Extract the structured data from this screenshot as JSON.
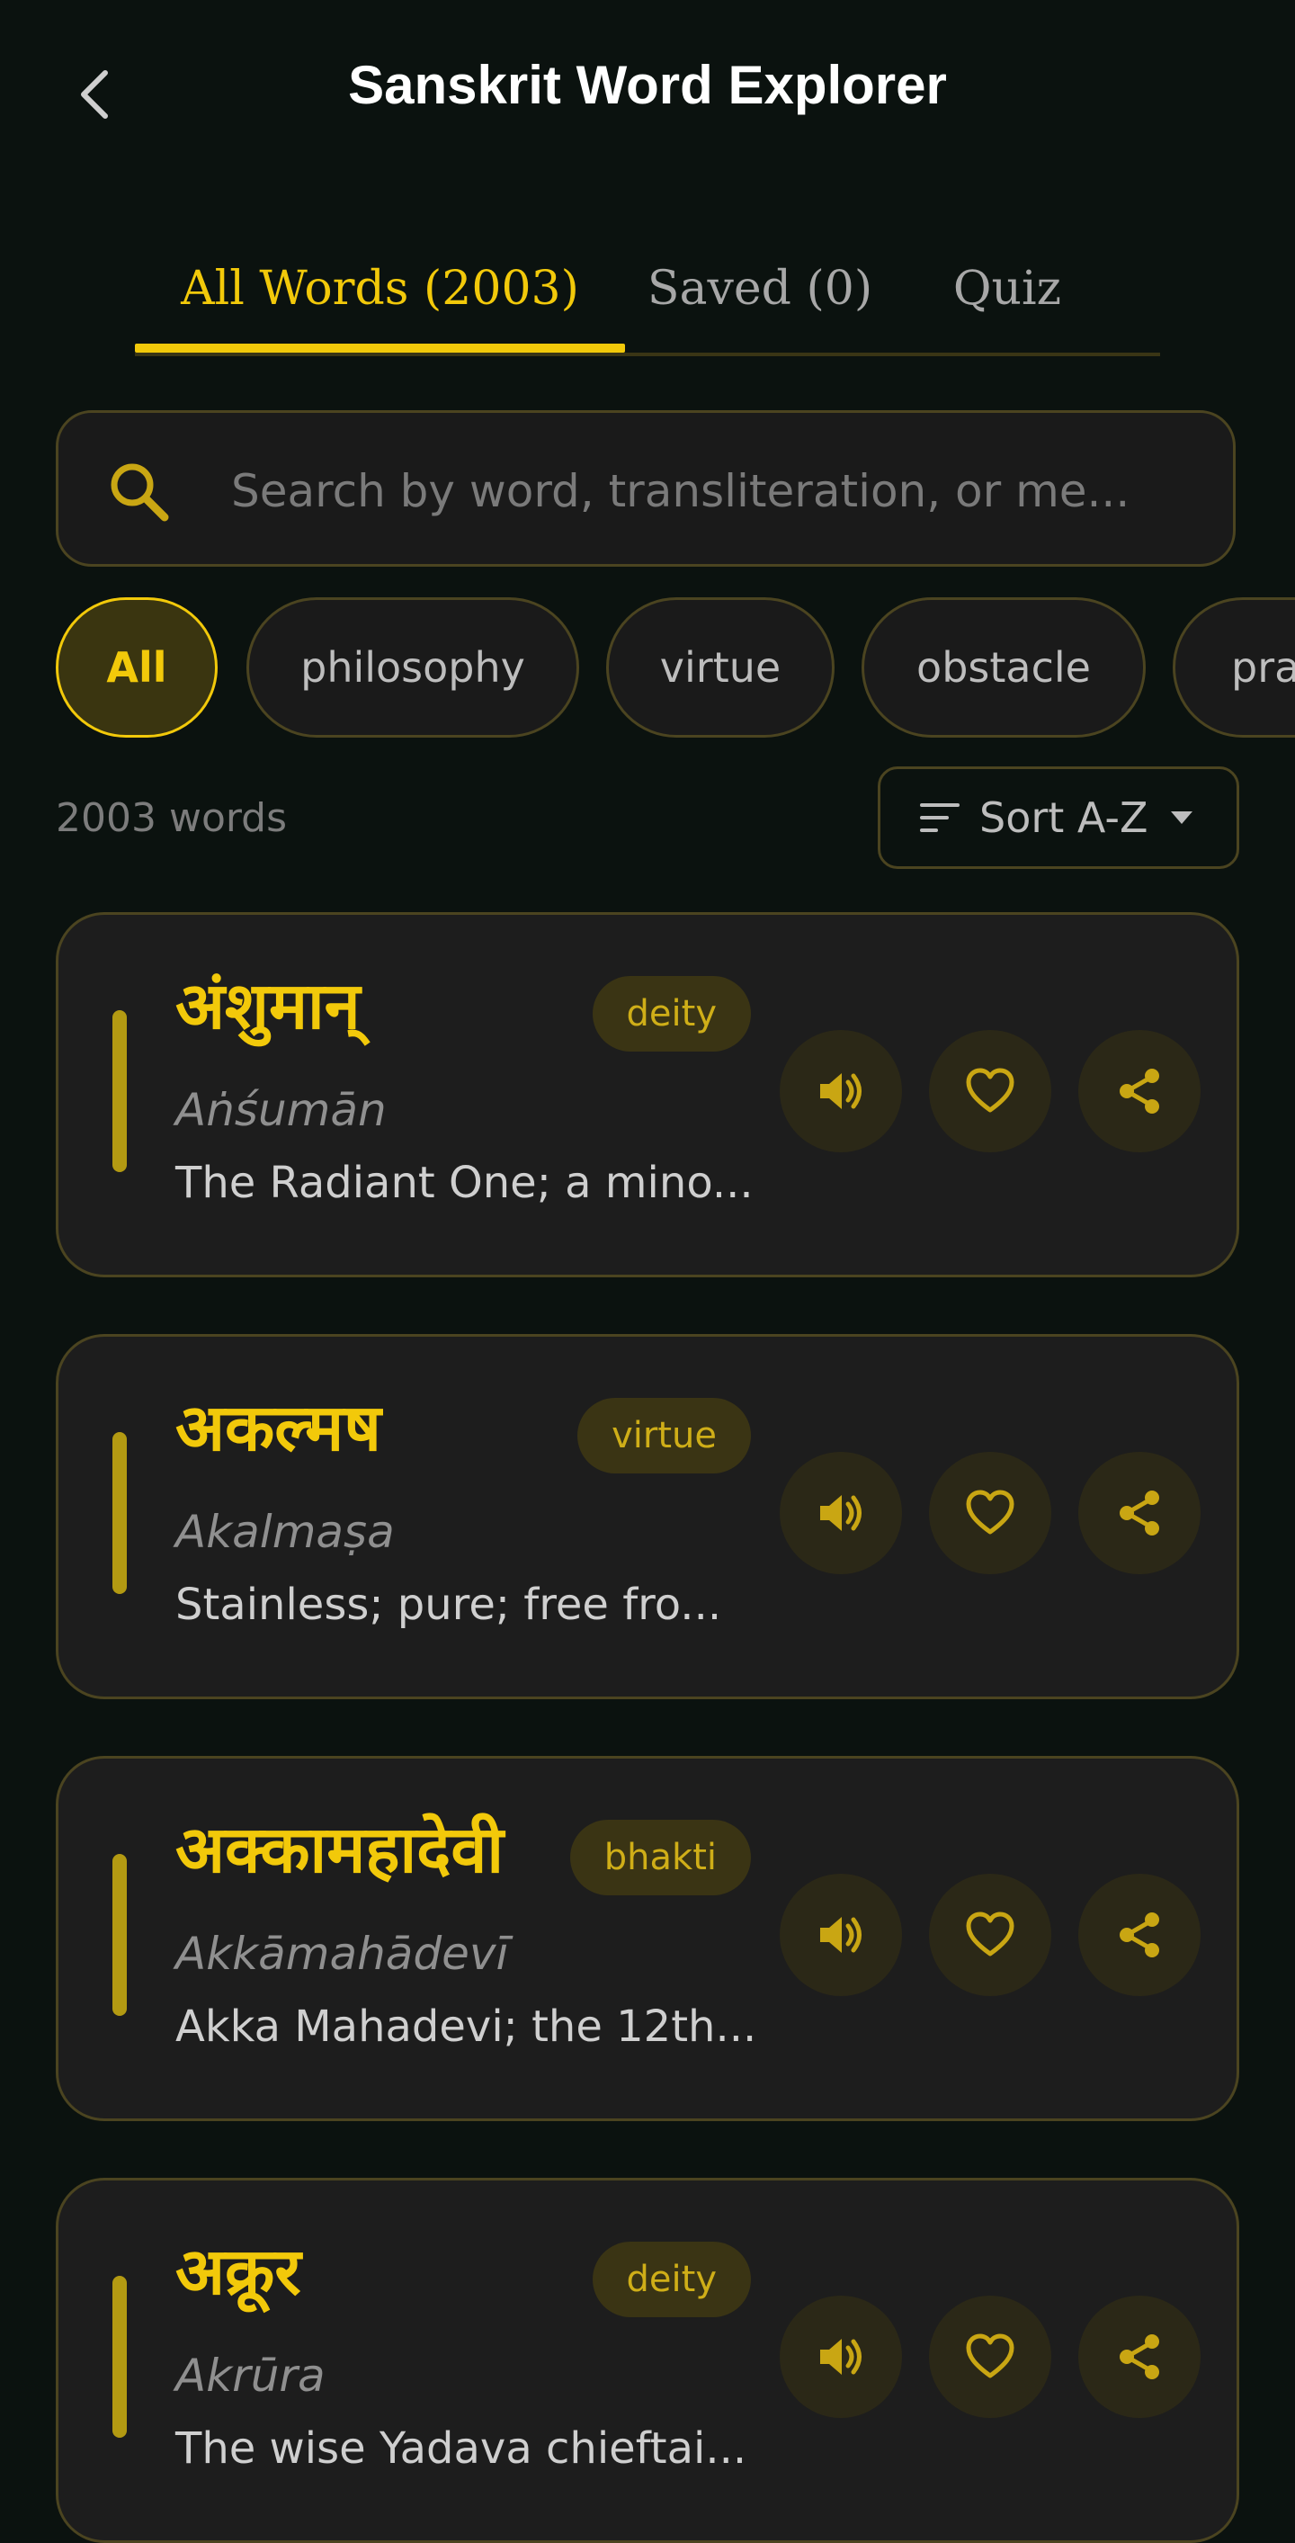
{
  "header": {
    "title": "Sanskrit Word Explorer"
  },
  "tabs": [
    {
      "label": "All Words (2003)"
    },
    {
      "label": "Saved (0)"
    },
    {
      "label": "Quiz"
    }
  ],
  "search": {
    "placeholder": "Search by word, transliteration, or me..."
  },
  "filters": [
    {
      "label": "All"
    },
    {
      "label": "philosophy"
    },
    {
      "label": "virtue"
    },
    {
      "label": "obstacle"
    },
    {
      "label": "pra"
    }
  ],
  "list": {
    "count": "2003 words",
    "sort_label": "Sort A-Z"
  },
  "words": [
    {
      "devanagari": "अंशुमान्",
      "translit": "Aṅśumān",
      "meaning": "The Radiant One; a mino...",
      "tag": "deity"
    },
    {
      "devanagari": "अकल्मष",
      "translit": "Akalmaṣa",
      "meaning": "Stainless; pure; free fro...",
      "tag": "virtue"
    },
    {
      "devanagari": "अक्कामहादेवी",
      "translit": "Akkāmahādevī",
      "meaning": "Akka Mahadevi; the 12th...",
      "tag": "bhakti"
    },
    {
      "devanagari": "अक्रूर",
      "translit": "Akrūra",
      "meaning": "The wise Yadava chieftai...",
      "tag": "deity"
    }
  ],
  "colors": {
    "accent": "#f2c90a",
    "background": "#0b120f",
    "card": "#1d1d1d"
  }
}
